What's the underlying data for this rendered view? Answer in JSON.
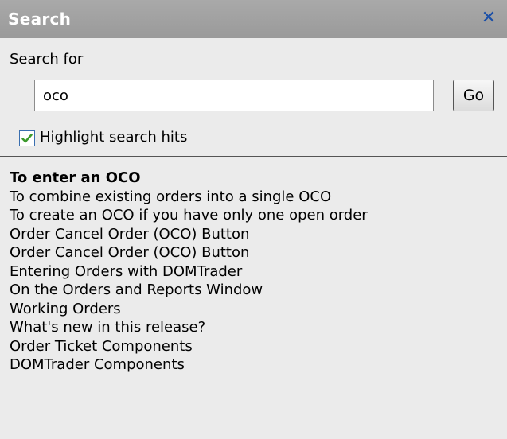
{
  "panel": {
    "title": "Search",
    "close_icon": "close-icon"
  },
  "search": {
    "label": "Search for",
    "value": "oco",
    "go_label": "Go",
    "highlight_checked": true,
    "highlight_label": "Highlight search hits"
  },
  "results": [
    "To enter an OCO",
    "To combine existing orders into a single OCO",
    "To create an OCO if you have only one open order",
    "Order Cancel Order (OCO) Button",
    "Order Cancel Order (OCO) Button",
    "Entering Orders with DOMTrader",
    "On the Orders and Reports Window",
    "Working Orders",
    "What's new in this release?",
    "Order Ticket Components",
    "DOMTrader Components"
  ],
  "colors": {
    "titlebar": "#a0a0a0",
    "panel_background": "#ebebeb",
    "close_icon": "#1a4fa8",
    "check_mark": "#3c9a2c"
  }
}
